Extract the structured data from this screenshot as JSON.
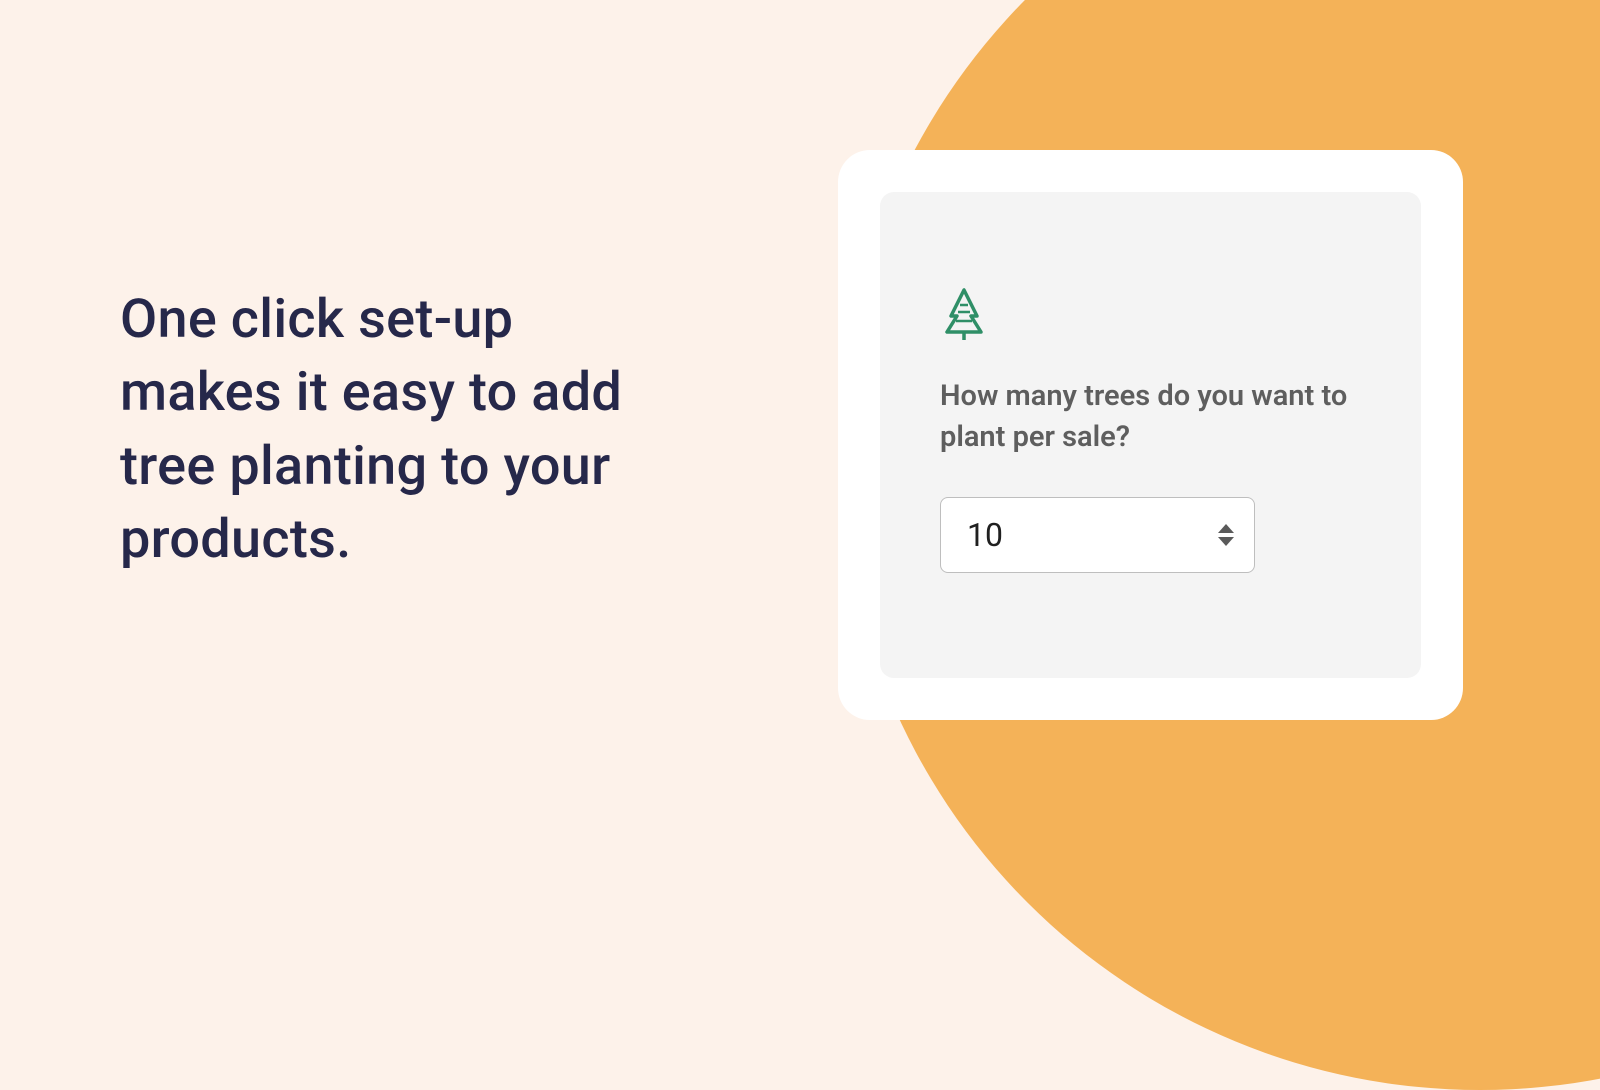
{
  "hero": {
    "headline": "One click set-up makes it easy to add tree planting to your products."
  },
  "card": {
    "question_label": "How many trees do you want to plant per sale?",
    "stepper_value": "10"
  },
  "colors": {
    "background": "#FDF2EA",
    "accent": "#F4B258",
    "headline_text": "#26284A",
    "tree_icon": "#2F8F67"
  }
}
